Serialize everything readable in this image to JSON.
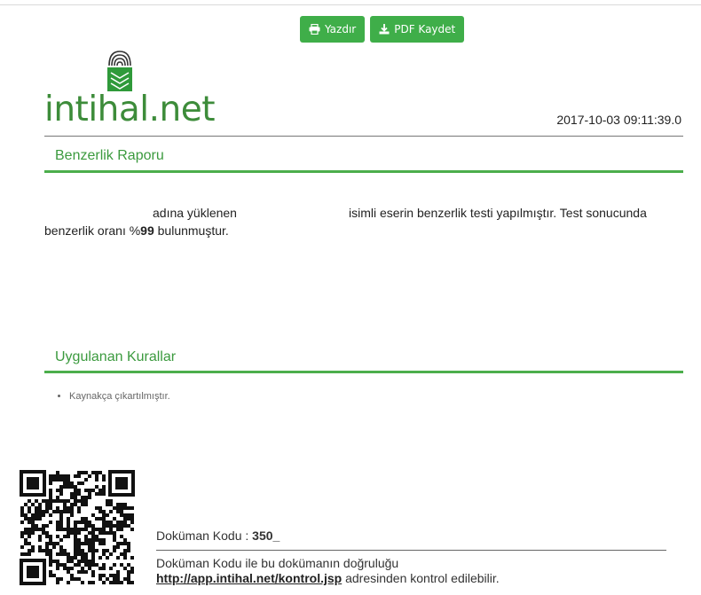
{
  "toolbar": {
    "print_label": "Yazdır",
    "pdf_label": "PDF Kaydet",
    "button_color": "#3fae49"
  },
  "header": {
    "logo_text": "intihal.net",
    "timestamp": "2017-10-03 09:11:39.0"
  },
  "report": {
    "title": "Benzerlik Raporu",
    "sentence_part1": "adına yüklenen",
    "sentence_part2": "isimli eserin benzerlik testi yapılmıştır. Test sonucunda",
    "sentence_part3": "benzerlik oranı %",
    "similarity_rate": "99",
    "sentence_part4": " bulunmuştur."
  },
  "rules": {
    "title": "Uygulanan Kurallar",
    "items": [
      "Kaynakça çıkartılmıştır."
    ]
  },
  "footer": {
    "doc_code_label": "Doküman Kodu : ",
    "doc_code_value": "350_",
    "note_text": "Doküman Kodu ile bu dokümanın doğruluğu",
    "verify_link": "http://app.intihal.net/kontrol.jsp",
    "note_suffix": " adresinden kontrol edilebilir."
  },
  "colors": {
    "accent_green": "#4cae4c",
    "title_green": "#3b9a3e",
    "logo_green": "#3d8c3a"
  }
}
